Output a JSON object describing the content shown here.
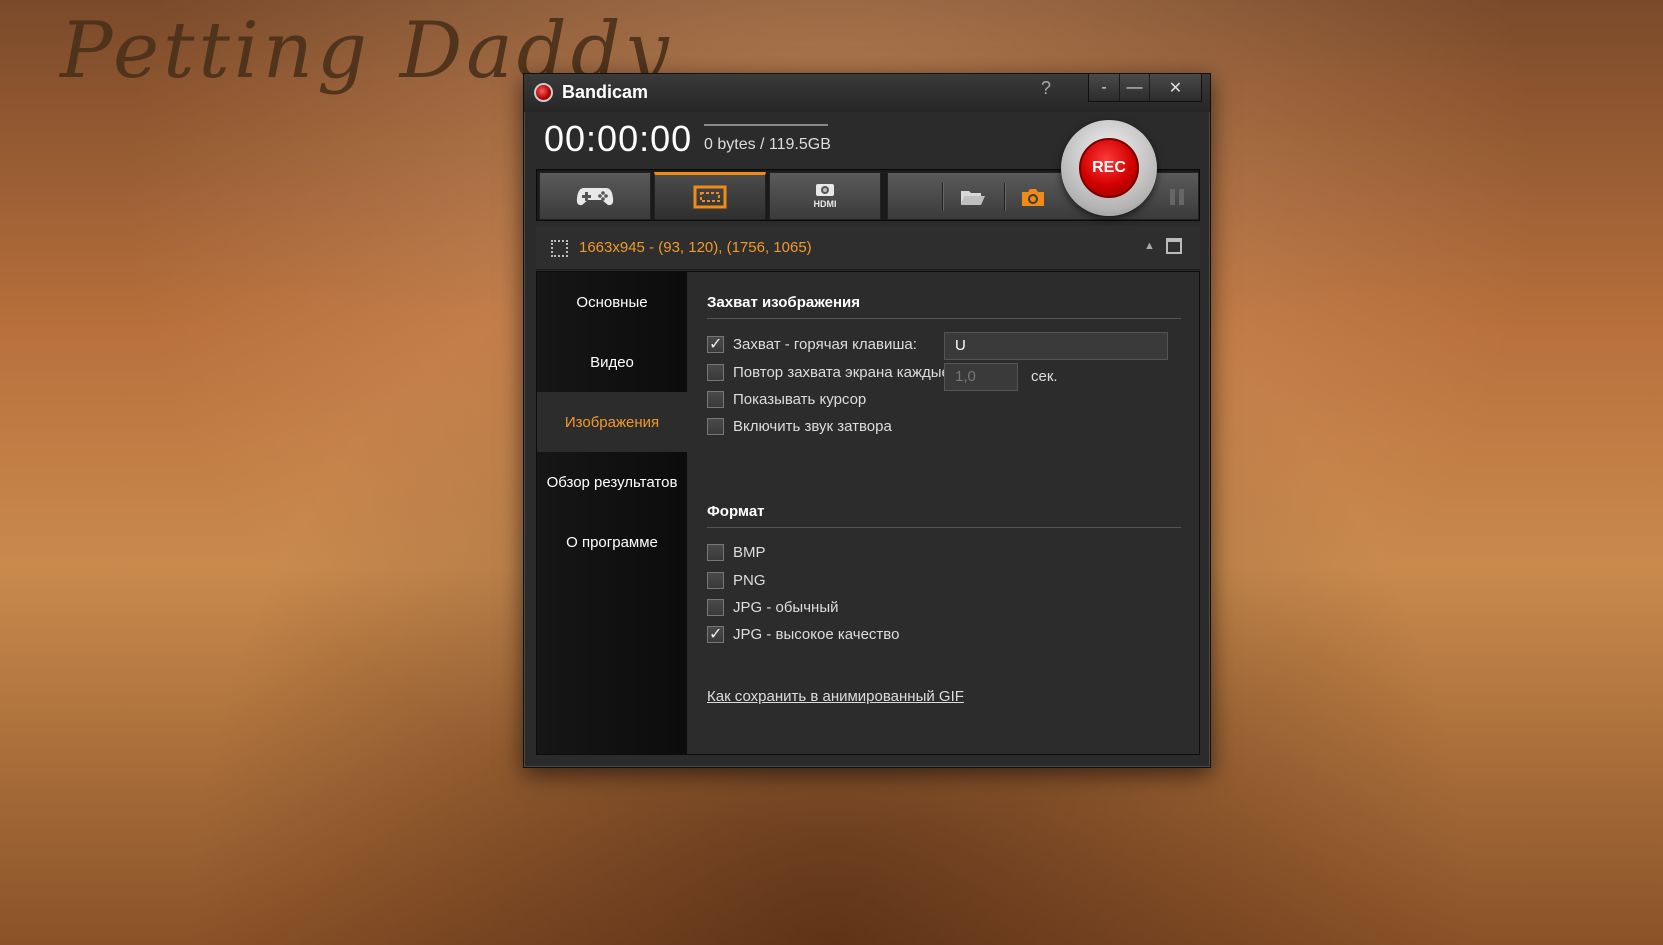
{
  "background": {
    "title": "Petting Daddy"
  },
  "window": {
    "app_title": "Bandicam",
    "help_label": "?",
    "buttons": {
      "mini": "-",
      "minimize": "—",
      "close": "✕"
    }
  },
  "status": {
    "timer": "00:00:00",
    "file_size": "0 bytes / 119.5GB"
  },
  "toolbar": {
    "tabs": [
      {
        "icon": "gamepad-icon",
        "active": false
      },
      {
        "icon": "screen-rectangle-icon",
        "active": true
      },
      {
        "icon": "hdmi-device-icon",
        "active": false
      }
    ],
    "icons": [
      "folder-icon",
      "camera-icon",
      "pause-icon"
    ],
    "rec_label": "REC",
    "hdmi_label": "HDMI"
  },
  "region": {
    "text": "1663x945 - (93, 120), (1756, 1065)"
  },
  "sidebar": {
    "items": [
      {
        "label": "Основные",
        "active": false
      },
      {
        "label": "Видео",
        "active": false
      },
      {
        "label": "Изображения",
        "active": true
      },
      {
        "label": "Обзор результатов",
        "active": false
      },
      {
        "label": "О программе",
        "active": false
      }
    ]
  },
  "capture": {
    "title": "Захват изображения",
    "hotkey_label": "Захват - горячая клавиша:",
    "hotkey_checked": true,
    "hotkey_value": "U",
    "repeat_label": "Повтор захвата экрана каждые",
    "repeat_checked": false,
    "repeat_value": "1,0",
    "repeat_unit": "сек.",
    "cursor_label": "Показывать курсор",
    "cursor_checked": false,
    "shutter_label": "Включить звук затвора",
    "shutter_checked": false
  },
  "format": {
    "title": "Формат",
    "options": [
      {
        "label": "BMP",
        "checked": false
      },
      {
        "label": "PNG",
        "checked": false
      },
      {
        "label": "JPG - обычный",
        "checked": false
      },
      {
        "label": "JPG - высокое качество",
        "checked": true
      }
    ],
    "gif_link": "Как сохранить в анимированный GIF"
  },
  "colors": {
    "accent": "#f19a2a",
    "rec_red": "#d10000",
    "window_bg": "#2b2b2b"
  }
}
